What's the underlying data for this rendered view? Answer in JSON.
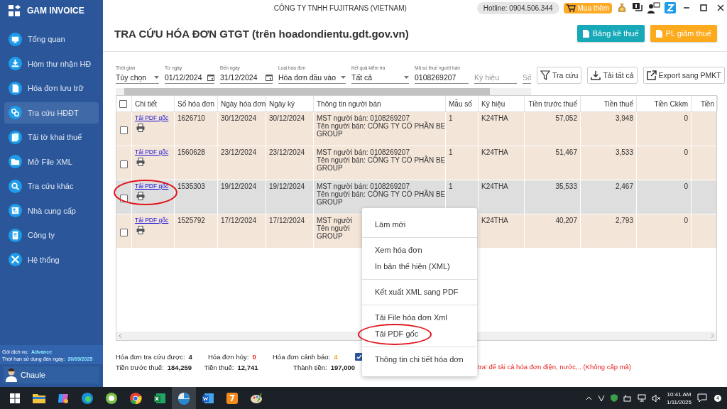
{
  "sidebar": {
    "brand": "GAM INVOICE",
    "items": [
      {
        "label": "Tổng quan",
        "selected": false
      },
      {
        "label": "Hòm thư nhận HĐ",
        "selected": false
      },
      {
        "label": "Hóa đơn lưu trữ",
        "selected": false
      },
      {
        "label": "Tra cứu HĐĐT",
        "selected": true
      },
      {
        "label": "Tải tờ khai thuế",
        "selected": false
      },
      {
        "label": "Mở File XML",
        "selected": false
      },
      {
        "label": "Tra cứu khác",
        "selected": false
      },
      {
        "label": "Nhà cung cấp",
        "selected": false
      },
      {
        "label": "Công ty",
        "selected": false
      },
      {
        "label": "Hệ thống",
        "selected": false
      }
    ],
    "plan_label": "Gói dịch vụ:",
    "plan_value": "Advance",
    "expiry_label": "Thời hạn sử dụng đến ngày:",
    "expiry_value": "30/09/2025",
    "user": "Chaule"
  },
  "topbar": {
    "company": "CÔNG TY TNHH FUJITRANS (VIETNAM)",
    "hotline": "Hotline: 0904.506.344",
    "buy_button": "Mua thêm"
  },
  "page": {
    "title": "TRA CỨU HÓA ĐƠN GTGT (trên hoadondientu.gdt.gov.vn)",
    "buttons": [
      {
        "label": "Bảng kê thuế",
        "color": "#17a9b8"
      },
      {
        "label": "PL giảm thuế",
        "color": "#fdaa1d"
      }
    ]
  },
  "filters": [
    {
      "kind": "select",
      "label": "Thời gian",
      "value": "Tùy chọn"
    },
    {
      "kind": "date",
      "label": "Từ ngày",
      "value": "01/12/2024"
    },
    {
      "kind": "date",
      "label": "Đến ngày",
      "value": "31/12/2024"
    },
    {
      "kind": "select",
      "label": "Loại hóa đơn",
      "value": "Hóa đơn đầu vào"
    },
    {
      "kind": "select",
      "label": "Kết quả kiểm tra",
      "value": "Tất cả"
    },
    {
      "kind": "text",
      "label": "Mã số thuế người bán",
      "value": "0108269207"
    },
    {
      "kind": "text",
      "placeholder": "Ký hiệu"
    },
    {
      "kind": "text",
      "placeholder": "Số"
    }
  ],
  "actions": [
    "Tra cứu",
    "Tải tất cả",
    "Export sang PMKT"
  ],
  "table": {
    "columns": [
      "Chi tiết",
      "Số hóa đơn",
      "Ngày hóa đơn",
      "Ngày ký",
      "Thông tin người bán",
      "Mẫu số",
      "Ký hiệu",
      "Tiền trước thuế",
      "Tiền thuế",
      "Tiền Ckkm",
      "Tiền"
    ],
    "header_checked": false,
    "rows": [
      {
        "checked": false,
        "selected": false,
        "circled": false,
        "link": "Tải PDF gốc",
        "so_hoa_don": "1626710",
        "ngay_hoa_don": "30/12/2024",
        "ngay_ky": "30/12/2024",
        "seller": [
          "MST người bán: 0108269207",
          "Tên người bán: CÔNG TY CỔ PHẦN BE",
          "GROUP"
        ],
        "mau_so": "1",
        "ky_hieu": "K24THA",
        "tien_truoc_thue": "57,052",
        "tien_thue": "3,948",
        "tien_ckkm": "0"
      },
      {
        "checked": false,
        "selected": false,
        "circled": false,
        "link": "Tải PDF gốc",
        "so_hoa_don": "1560628",
        "ngay_hoa_don": "23/12/2024",
        "ngay_ky": "23/12/2024",
        "seller": [
          "MST người bán: 0108269207",
          "Tên người bán: CÔNG TY CỔ PHẦN BE",
          "GROUP"
        ],
        "mau_so": "1",
        "ky_hieu": "K24THA",
        "tien_truoc_thue": "51,467",
        "tien_thue": "3,533",
        "tien_ckkm": "0"
      },
      {
        "checked": false,
        "selected": true,
        "circled": true,
        "link": "Tải PDF gốc",
        "so_hoa_don": "1535303",
        "ngay_hoa_don": "19/12/2024",
        "ngay_ky": "19/12/2024",
        "seller": [
          "MST người bán: 0108269207",
          "Tên người bán: CÔNG TY CỔ PHẦN BE",
          "GROUP"
        ],
        "mau_so": "1",
        "ky_hieu": "K24THA",
        "tien_truoc_thue": "35,533",
        "tien_thue": "2,467",
        "tien_ckkm": "0"
      },
      {
        "checked": false,
        "selected": false,
        "circled": false,
        "link": "Tải PDF gốc",
        "so_hoa_don": "1525792",
        "ngay_hoa_don": "17/12/2024",
        "ngay_ky": "17/12/2024",
        "seller": [
          "MST người",
          "Tên người",
          "GROUP"
        ],
        "ky_hieu": "K24THA",
        "tien_truoc_thue": "40,207",
        "tien_thue": "2,793",
        "tien_ckkm": "0"
      }
    ]
  },
  "summary": {
    "lines": [
      [
        {
          "label": "Hóa đơn tra cứu được:",
          "value": "4",
          "color": "#222222"
        },
        {
          "label": "Hóa đơn hủy:",
          "value": "0",
          "color": "#e8201e"
        },
        {
          "label": "Hóa đơn cảnh báo:",
          "value": "4",
          "color": "#f3a21b"
        }
      ],
      [
        {
          "label": "Tiền trước thuế:",
          "value": "184,259",
          "color": "#222222"
        },
        {
          "label": "Tiền thuế:",
          "value": "12,741",
          "color": "#222222"
        },
        {
          "label": "Thành tiền:",
          "value": "197,000",
          "color": "#222222"
        }
      ]
    ],
    "option_checked": true,
    "note": "tra' để tải cả hóa đơn điện, nước,.. (Không cấp mã)"
  },
  "context_menu": {
    "groups": [
      [
        {
          "label": "Làm mới",
          "circled": false
        }
      ],
      [
        {
          "label": "Xem hóa đơn",
          "circled": false
        },
        {
          "label": "In bản thể hiện (XML)",
          "circled": false
        }
      ],
      [
        {
          "label": "Kết xuất XML sang PDF",
          "circled": false
        }
      ],
      [
        {
          "label": "Tải File hóa đơn Xml",
          "circled": false
        },
        {
          "label": "Tải PDF gốc",
          "circled": true
        }
      ],
      [
        {
          "label": "Thông tin chi tiết hóa đơn",
          "circled": false
        }
      ]
    ]
  },
  "taskbar": {
    "time": "10:41 AM",
    "date": "1/11/2025",
    "notifications": "4"
  }
}
